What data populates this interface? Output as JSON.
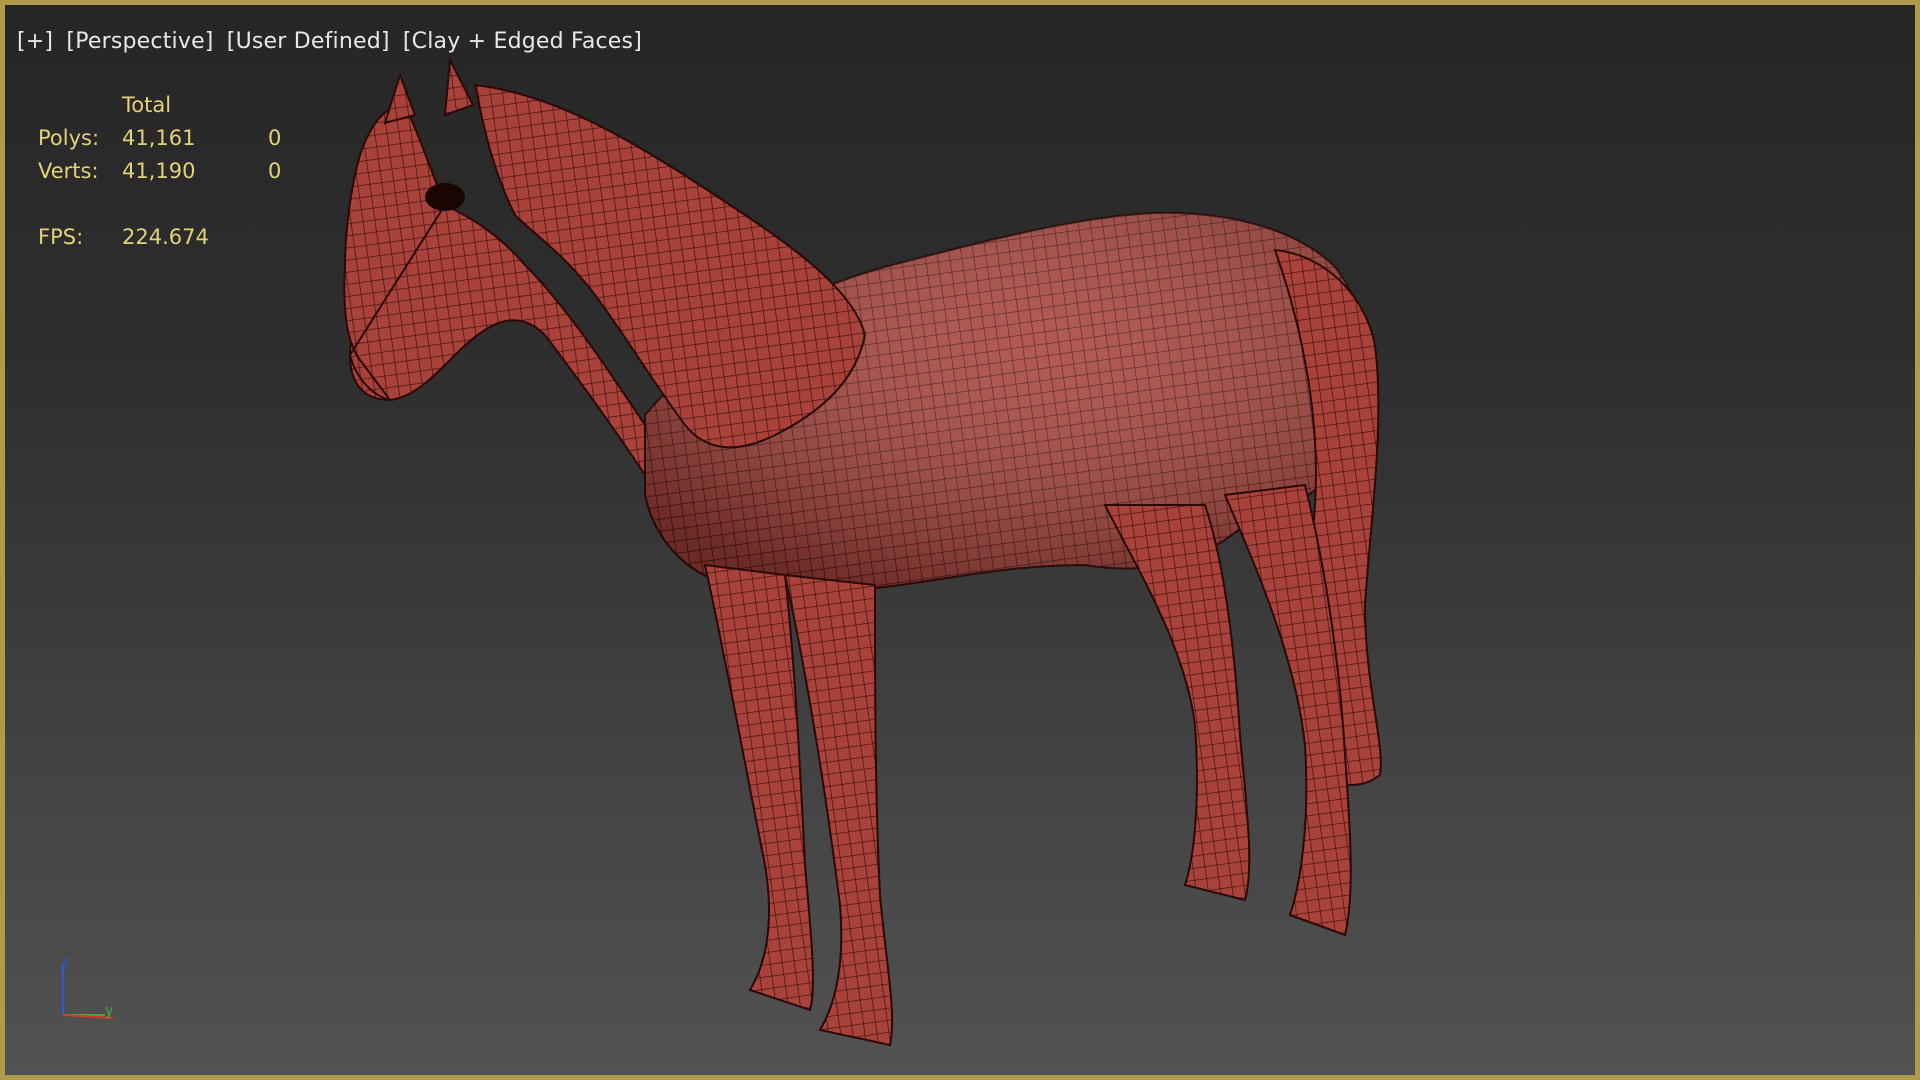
{
  "viewport": {
    "labels": [
      "[+]",
      "[Perspective]",
      "[User Defined]",
      "[Clay + Edged Faces]"
    ]
  },
  "stats": {
    "header": "Total",
    "rows": [
      {
        "label": "Polys:",
        "total": "41,161",
        "selected": "0"
      },
      {
        "label": "Verts:",
        "total": "41,190",
        "selected": "0"
      }
    ],
    "fps_label": "FPS:",
    "fps_value": "224.674"
  },
  "axis": {
    "z": "z",
    "y": "y"
  },
  "colors": {
    "border": "#b09a4e",
    "stats_text": "#e3d27a",
    "mesh_fill": "#a8423a",
    "mesh_wire": "#3a0e0c",
    "axis_z": "#2a5bd7",
    "axis_y": "#3fae3a",
    "axis_x": "#d23a2a"
  }
}
